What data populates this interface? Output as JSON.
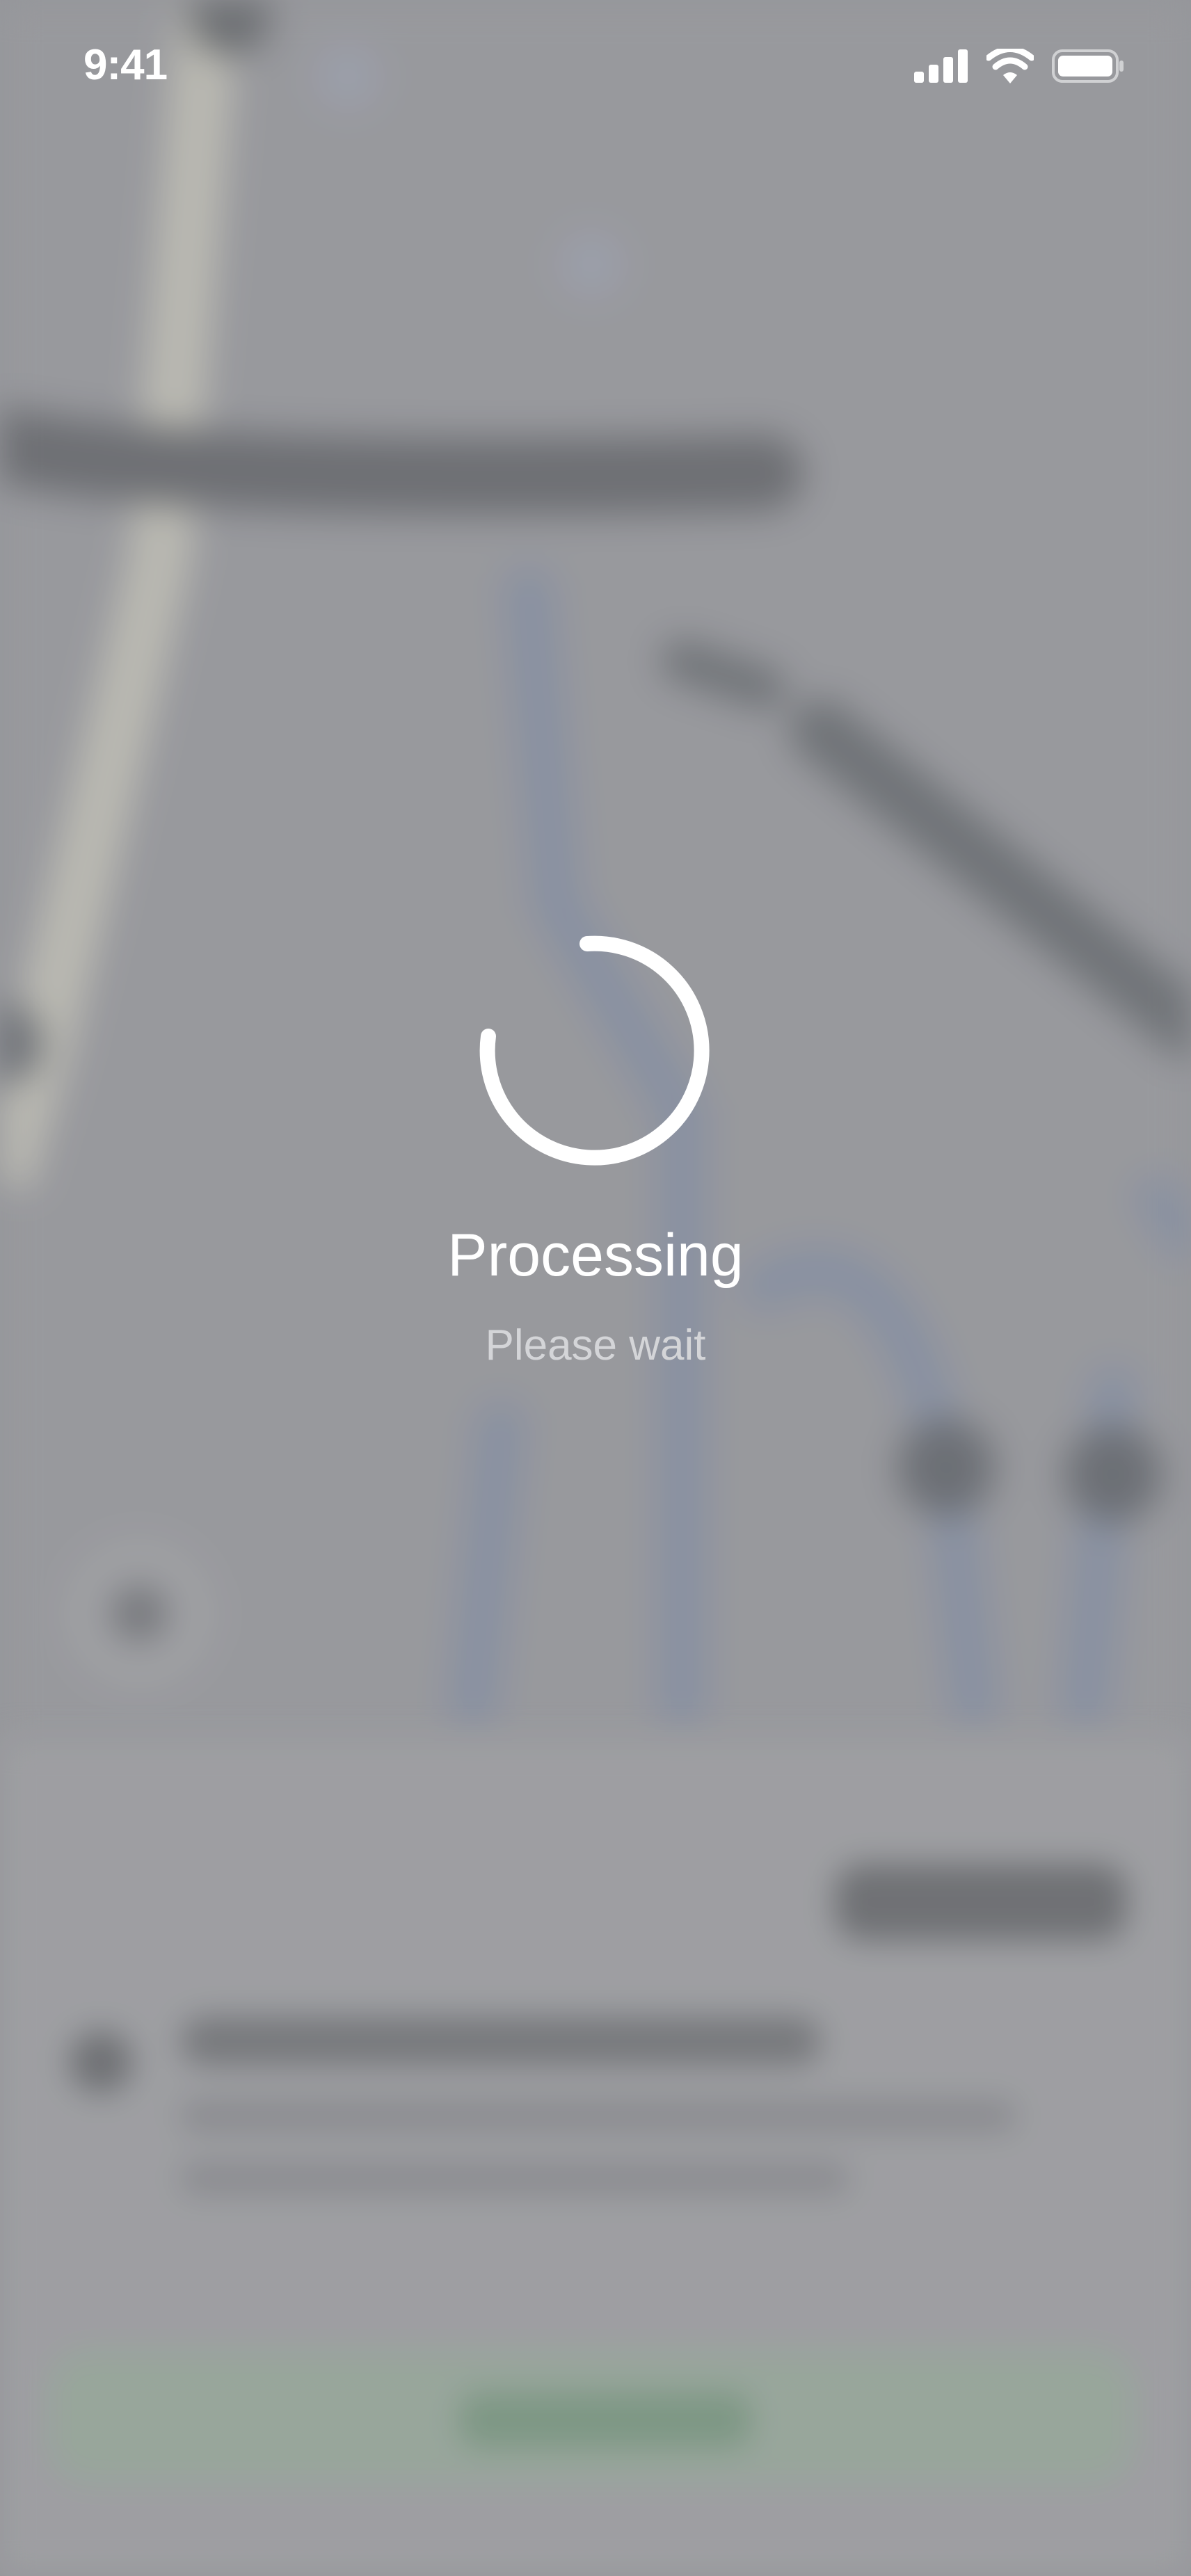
{
  "status_bar": {
    "time": "9:41",
    "icons": [
      "signal-icon",
      "wifi-icon",
      "battery-icon"
    ]
  },
  "loading": {
    "title": "Processing",
    "subtitle": "Please wait",
    "spinner_color": "#ffffff"
  },
  "colors": {
    "overlay": "#9c9da1",
    "text_primary": "#ffffff",
    "text_secondary": "#d4d5d8"
  }
}
